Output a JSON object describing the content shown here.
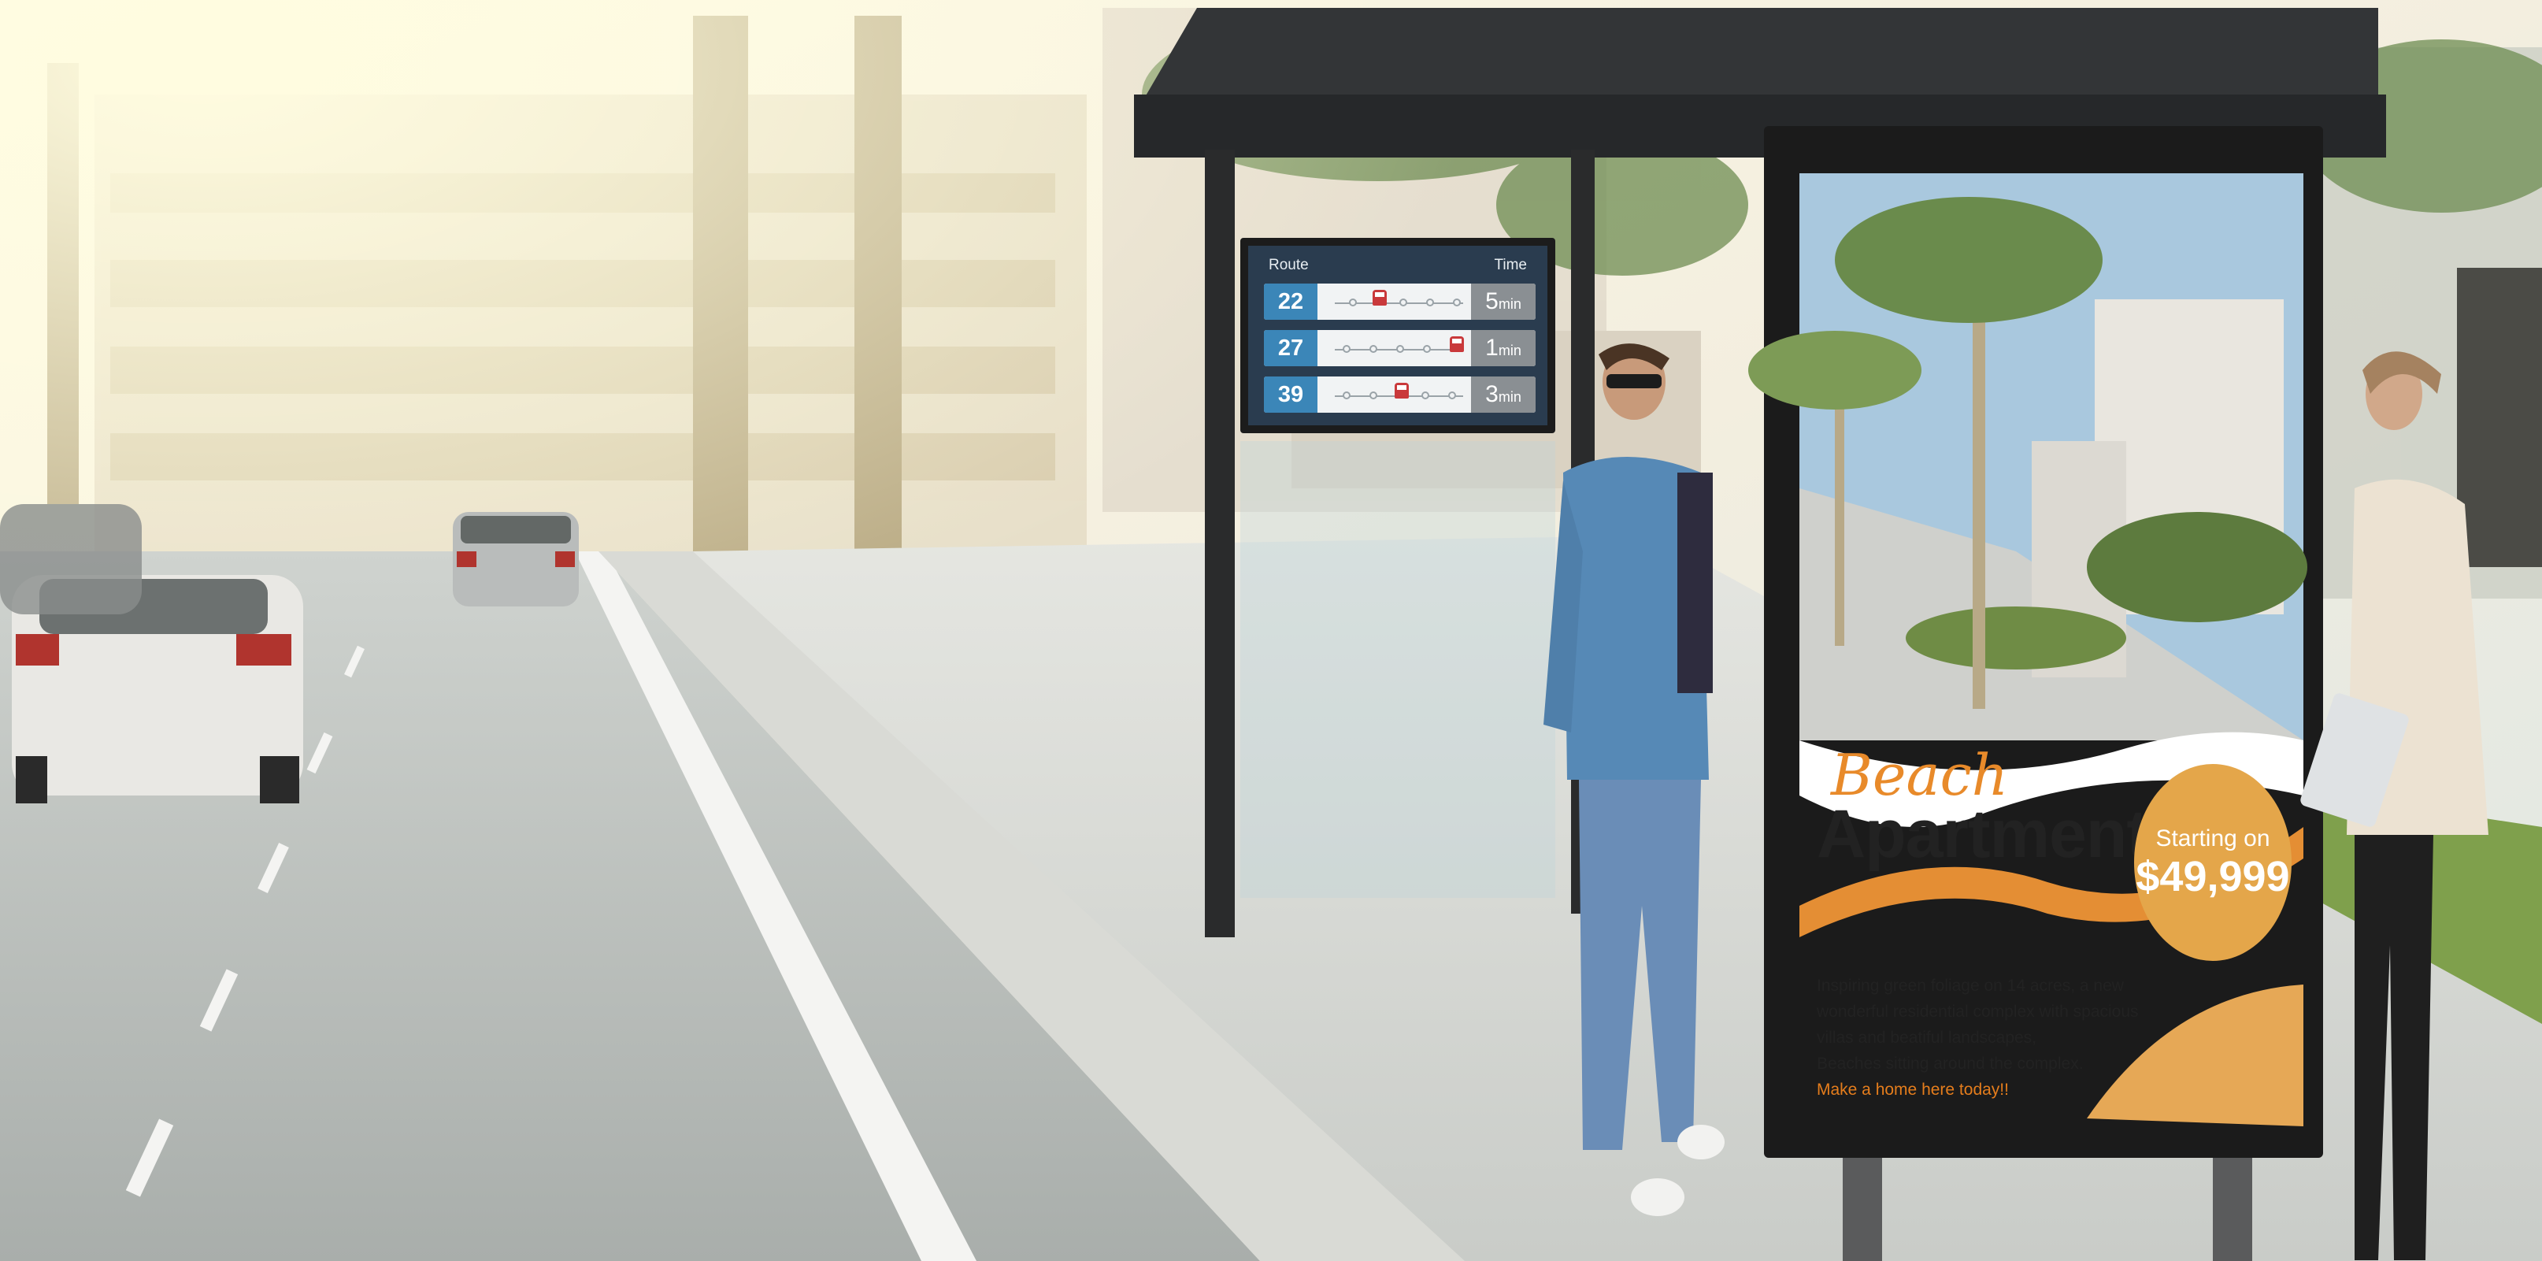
{
  "route_display": {
    "header_route": "Route",
    "header_time": "Time",
    "rows": [
      {
        "route": "22",
        "minutes": "5",
        "unit": "min",
        "bus_stop_index": 1
      },
      {
        "route": "27",
        "minutes": "1",
        "unit": "min",
        "bus_stop_index": 4
      },
      {
        "route": "39",
        "minutes": "3",
        "unit": "min",
        "bus_stop_index": 2
      }
    ]
  },
  "poster": {
    "title_script": "Beach",
    "title_main": "Apartments",
    "price_label": "Starting on",
    "price_value": "$49,999",
    "body_lines": [
      "Inspiring green foliage on 14 acres, a new",
      "wonderful residential complex with spacious",
      "villas and beatiful landscapes,",
      "Beaches sitting around the complex."
    ],
    "call_to_action": "Make a home here today!!"
  },
  "colors": {
    "route_blue": "#3b86b8",
    "poster_orange": "#e88a2a",
    "badge_gold": "#e4a64a"
  }
}
